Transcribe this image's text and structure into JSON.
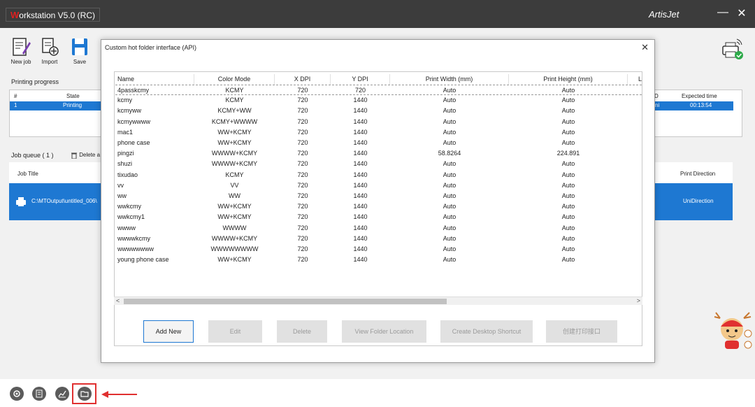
{
  "window": {
    "title_first_letter": "W",
    "title_rest": "orkstation V5.0 (RC)",
    "brand": "ArtisJet",
    "minimize_glyph": "—",
    "close_glyph": "✕"
  },
  "toolbar": {
    "new_job": "New job",
    "import": "Import",
    "save": "Save"
  },
  "progress": {
    "label": "Printing progress",
    "columns": [
      "#",
      "State",
      "D",
      "Expected time"
    ],
    "row": {
      "index": "1",
      "state": "Printing",
      "d": "ni",
      "expected_time": "00:13:54"
    }
  },
  "job_queue": {
    "label": "Job queue ( 1 )",
    "delete_label": "Delete a",
    "columns": {
      "title": "Job Title",
      "direction": "Print Direction"
    },
    "row": {
      "title": "C:\\MTOutput\\untitled_006\\",
      "direction": "UniDirection"
    }
  },
  "dialog": {
    "title": "Custom hot folder interface (API)",
    "close_glyph": "✕",
    "columns": [
      "Name",
      "Color Mode",
      "X DPI",
      "Y DPI",
      "Print Width (mm)",
      "Print Height (mm)",
      "L"
    ],
    "rows": [
      [
        "4passkcmy",
        "KCMY",
        "720",
        "720",
        "Auto",
        "Auto"
      ],
      [
        "kcmy",
        "KCMY",
        "720",
        "1440",
        "Auto",
        "Auto"
      ],
      [
        "kcmyww",
        "KCMY+WW",
        "720",
        "1440",
        "Auto",
        "Auto"
      ],
      [
        "kcmywwww",
        "KCMY+WWWW",
        "720",
        "1440",
        "Auto",
        "Auto"
      ],
      [
        "mac1",
        "WW+KCMY",
        "720",
        "1440",
        "Auto",
        "Auto"
      ],
      [
        "phone case",
        "WW+KCMY",
        "720",
        "1440",
        "Auto",
        "Auto"
      ],
      [
        "pingzi",
        "WWWW+KCMY",
        "720",
        "1440",
        "58.8264",
        "224.891"
      ],
      [
        "shuzi",
        "WWWW+KCMY",
        "720",
        "1440",
        "Auto",
        "Auto"
      ],
      [
        "tixudao",
        "KCMY",
        "720",
        "1440",
        "Auto",
        "Auto"
      ],
      [
        "vv",
        "VV",
        "720",
        "1440",
        "Auto",
        "Auto"
      ],
      [
        "ww",
        "WW",
        "720",
        "1440",
        "Auto",
        "Auto"
      ],
      [
        "wwkcmy",
        "WW+KCMY",
        "720",
        "1440",
        "Auto",
        "Auto"
      ],
      [
        "wwkcmy1",
        "WW+KCMY",
        "720",
        "1440",
        "Auto",
        "Auto"
      ],
      [
        "wwww",
        "WWWW",
        "720",
        "1440",
        "Auto",
        "Auto"
      ],
      [
        "wwwwkcmy",
        "WWWW+KCMY",
        "720",
        "1440",
        "Auto",
        "Auto"
      ],
      [
        "wwwwwwww",
        "WWWWWWWW",
        "720",
        "1440",
        "Auto",
        "Auto"
      ],
      [
        "young phone case",
        "WW+KCMY",
        "720",
        "1440",
        "Auto",
        "Auto"
      ]
    ],
    "scroll_left": "<",
    "scroll_right": ">",
    "buttons": {
      "add_new": "Add New",
      "edit": "Edit",
      "delete": "Delete",
      "view_folder": "View Folder Location",
      "create_shortcut": "Create Desktop Shortcut",
      "create_print_interface": "创建打印接口"
    }
  },
  "colors": {
    "accent": "#1e78d2",
    "titlebar": "#3c3c3c",
    "highlight": "#e03030"
  },
  "icons": [
    "settings-icon",
    "log-icon",
    "statistics-icon",
    "hot-folder-icon",
    "printer-icon",
    "network-printer-icon",
    "mascot-icon"
  ]
}
